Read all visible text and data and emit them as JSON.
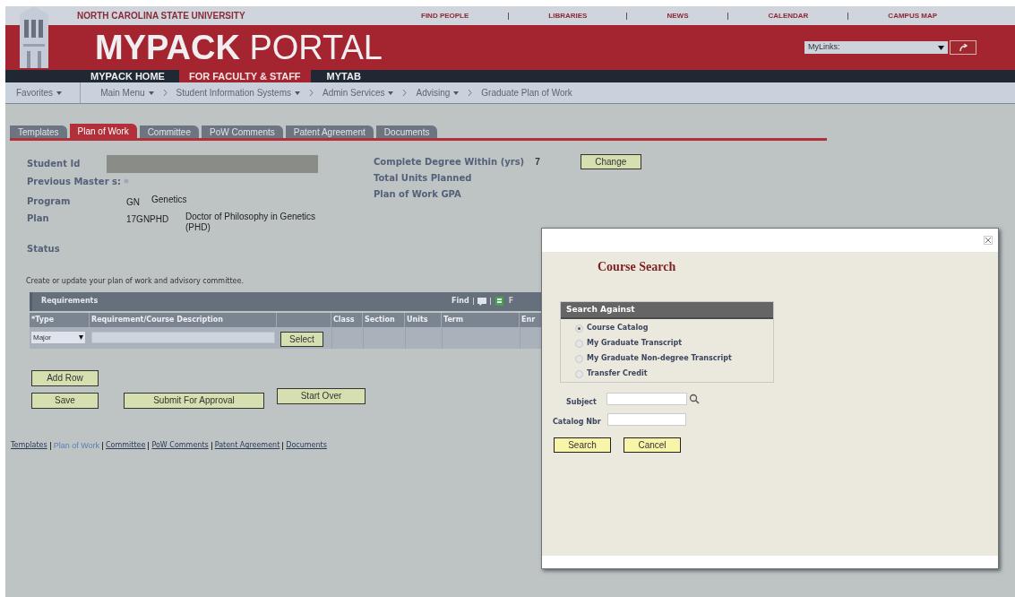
{
  "university": "NORTH CAROLINA STATE UNIVERSITY",
  "top_links": [
    "FIND PEOPLE",
    "LIBRARIES",
    "NEWS",
    "CALENDAR",
    "CAMPUS MAP"
  ],
  "portal_title": {
    "bold": "MYPACK",
    "light": "PORTAL"
  },
  "mylinks": {
    "value": "MyLinks:"
  },
  "nav_tabs": [
    {
      "label": "MYPACK HOME",
      "selected": false
    },
    {
      "label": "FOR FACULTY & STAFF",
      "selected": true
    },
    {
      "label": "MYTAB",
      "selected": false
    }
  ],
  "breadcrumbs": [
    {
      "label": "Favorites",
      "dropdown": true
    },
    {
      "label": "Main Menu",
      "dropdown": true
    },
    {
      "label": "Student Information Systems",
      "dropdown": true
    },
    {
      "label": "Admin Services",
      "dropdown": true
    },
    {
      "label": "Advising",
      "dropdown": true
    },
    {
      "label": "Graduate Plan of Work",
      "dropdown": false
    }
  ],
  "tabs": [
    {
      "label": "Templates",
      "selected": false
    },
    {
      "label": "Plan of Work",
      "selected": true
    },
    {
      "label": "Committee",
      "selected": false
    },
    {
      "label": "PoW Comments",
      "selected": false
    },
    {
      "label": "Patent Agreement",
      "selected": false
    },
    {
      "label": "Documents",
      "selected": false
    }
  ],
  "summary_left": [
    {
      "label": "Student Id",
      "kind": "redacted"
    },
    {
      "label": "Previous Master s:",
      "kind": "help"
    },
    {
      "label": "Program",
      "kind": "value",
      "code": "GN",
      "value": "Genetics"
    },
    {
      "label": "Plan",
      "kind": "value",
      "code": "17GNPHD",
      "value": "Doctor of Philosophy in Genetics (PHD)"
    },
    {
      "label": "Status",
      "kind": "empty"
    }
  ],
  "summary_right": [
    {
      "label": "Complete Degree Within (yrs)",
      "value": "7"
    },
    {
      "label": "Total Units Planned"
    },
    {
      "label": "Plan of Work GPA"
    }
  ],
  "change_button": "Change",
  "instructions": "Create or update your plan of work and advisory committee.",
  "requirements": {
    "title": "Requirements",
    "find": "Find",
    "cut_link": "F",
    "columns": [
      "*Type",
      "Requirement/Course Description",
      "Class",
      "Section",
      "Units",
      "Term",
      "Enr"
    ],
    "rows": [
      {
        "type": "Major",
        "button": "Select"
      }
    ]
  },
  "buttons": [
    "Add Row",
    "Save",
    "Submit For Approval",
    "Start Over"
  ],
  "bottom_links": [
    {
      "label": "Templates",
      "selected": false
    },
    {
      "label": "Plan of Work",
      "selected": true
    },
    {
      "label": "Committee",
      "selected": false
    },
    {
      "label": "PoW Comments",
      "selected": false
    },
    {
      "label": "Patent Agreement",
      "selected": false
    },
    {
      "label": "Documents",
      "selected": false
    }
  ],
  "dialog": {
    "title": "Course Search",
    "group_title": "Search Against",
    "options": [
      {
        "label": "Course Catalog",
        "selected": true
      },
      {
        "label": "My Graduate Transcript",
        "selected": false
      },
      {
        "label": "My Graduate Non-degree Transcript",
        "selected": false
      },
      {
        "label": "Transfer Credit",
        "selected": false
      }
    ],
    "subject_label": "Subject",
    "catalog_label": "Catalog Nbr",
    "buttons": [
      "Search",
      "Cancel"
    ]
  }
}
